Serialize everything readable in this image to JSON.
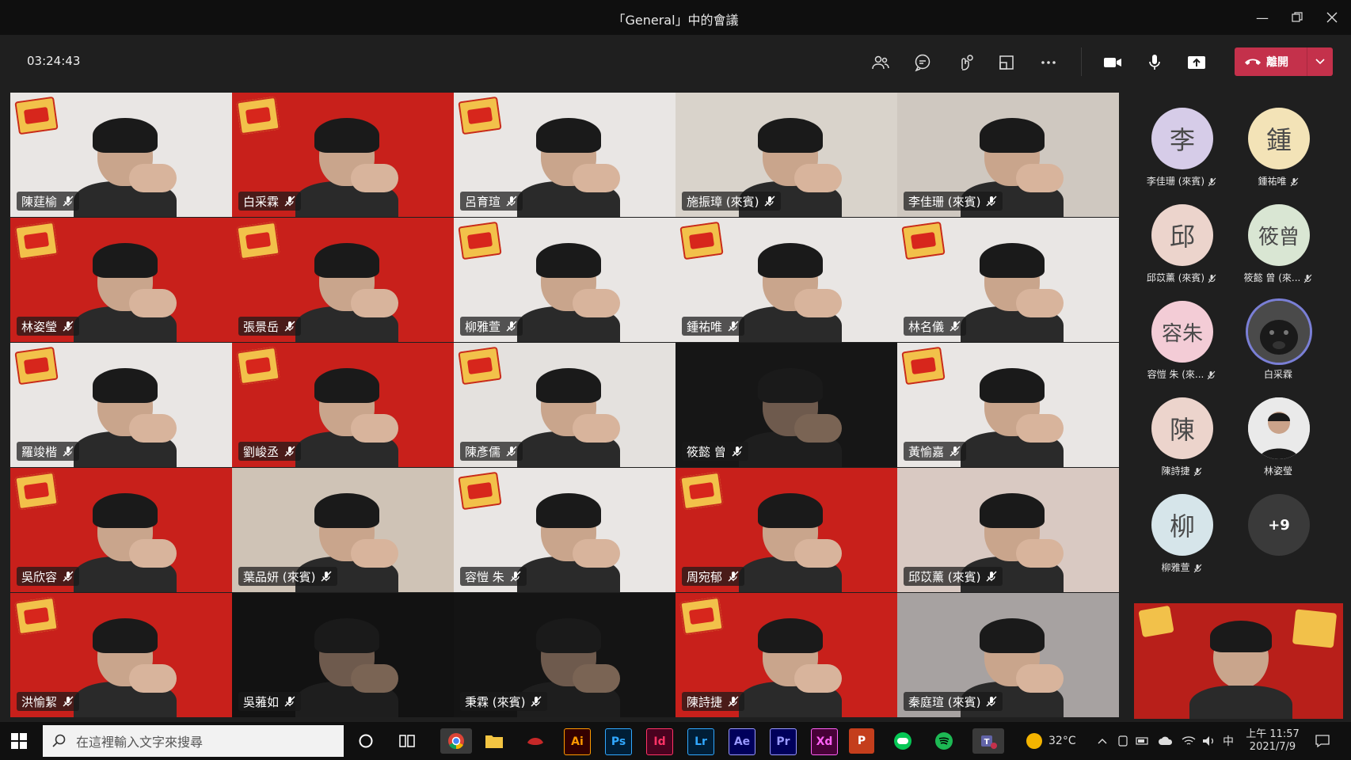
{
  "window": {
    "title": "「General」中的會議",
    "controls": [
      "minimize-icon",
      "restore-icon",
      "close-icon"
    ]
  },
  "toolbar": {
    "timer": "03:24:43",
    "leave_label": "離開",
    "icons": [
      "participants-icon",
      "chat-icon",
      "reactions-icon",
      "rooms-icon",
      "more-icon",
      "camera-icon",
      "mic-icon",
      "share-icon"
    ]
  },
  "tiles": [
    {
      "name": "陳莛榆"
    },
    {
      "name": "白采霖"
    },
    {
      "name": "呂育瑄"
    },
    {
      "name": "施振璋 (來賓)"
    },
    {
      "name": "李佳珊 (來賓)"
    },
    {
      "name": "林姿瑩"
    },
    {
      "name": "張景岳"
    },
    {
      "name": "柳雅萱"
    },
    {
      "name": "鍾祐唯"
    },
    {
      "name": "林名儀"
    },
    {
      "name": "羅竣楷"
    },
    {
      "name": "劉峻丞"
    },
    {
      "name": "陳彥儒"
    },
    {
      "name": "筱懿 曾"
    },
    {
      "name": "黃愉嘉"
    },
    {
      "name": "吳欣容"
    },
    {
      "name": "葉品妍 (來賓)"
    },
    {
      "name": "容愷 朱"
    },
    {
      "name": "周宛郁"
    },
    {
      "name": "邱苡薰 (來賓)"
    },
    {
      "name": "洪愉絜"
    },
    {
      "name": "吳蕥如"
    },
    {
      "name": "秉霖 (來賓)"
    },
    {
      "name": "陳詩捷"
    },
    {
      "name": "秦庭瑄 (來賓)"
    }
  ],
  "roster": [
    {
      "initials": "李",
      "name": "李佳珊 (來賓)",
      "color": "#d6cce8",
      "muted": true
    },
    {
      "initials": "鍾",
      "name": "鍾祐唯",
      "color": "#f3e3b7",
      "muted": true
    },
    {
      "initials": "邱",
      "name": "邱苡薰 (來賓)",
      "color": "#ecd4cc",
      "muted": true
    },
    {
      "initials": "筱曾",
      "name": "筱懿 曾 (來...",
      "color": "#d9e6d3",
      "muted": true
    },
    {
      "initials": "容朱",
      "name": "容愷 朱 (來...",
      "color": "#f3ccd6",
      "muted": true
    },
    {
      "initials": "",
      "name": "白采霖",
      "color": "#5a5a5a",
      "muted": false
    },
    {
      "initials": "陳",
      "name": "陳詩捷",
      "color": "#ecd4cc",
      "muted": true
    },
    {
      "initials": "",
      "name": "林姿瑩",
      "color": "#e9e9e9",
      "muted": false
    },
    {
      "initials": "柳",
      "name": "柳雅萱",
      "color": "#d6e5ea",
      "muted": true
    },
    {
      "initials": "+9",
      "name": "",
      "color": "#3a3a3a",
      "muted": false
    }
  ],
  "taskbar": {
    "search_placeholder": "在這裡輸入文字來搜尋",
    "apps": [
      "Ai",
      "Ps",
      "Id",
      "Lr",
      "Ae",
      "Pr",
      "Xd"
    ],
    "weather": "32°C",
    "ime": "中",
    "time": "上午 11:57",
    "date": "2021/7/9"
  }
}
